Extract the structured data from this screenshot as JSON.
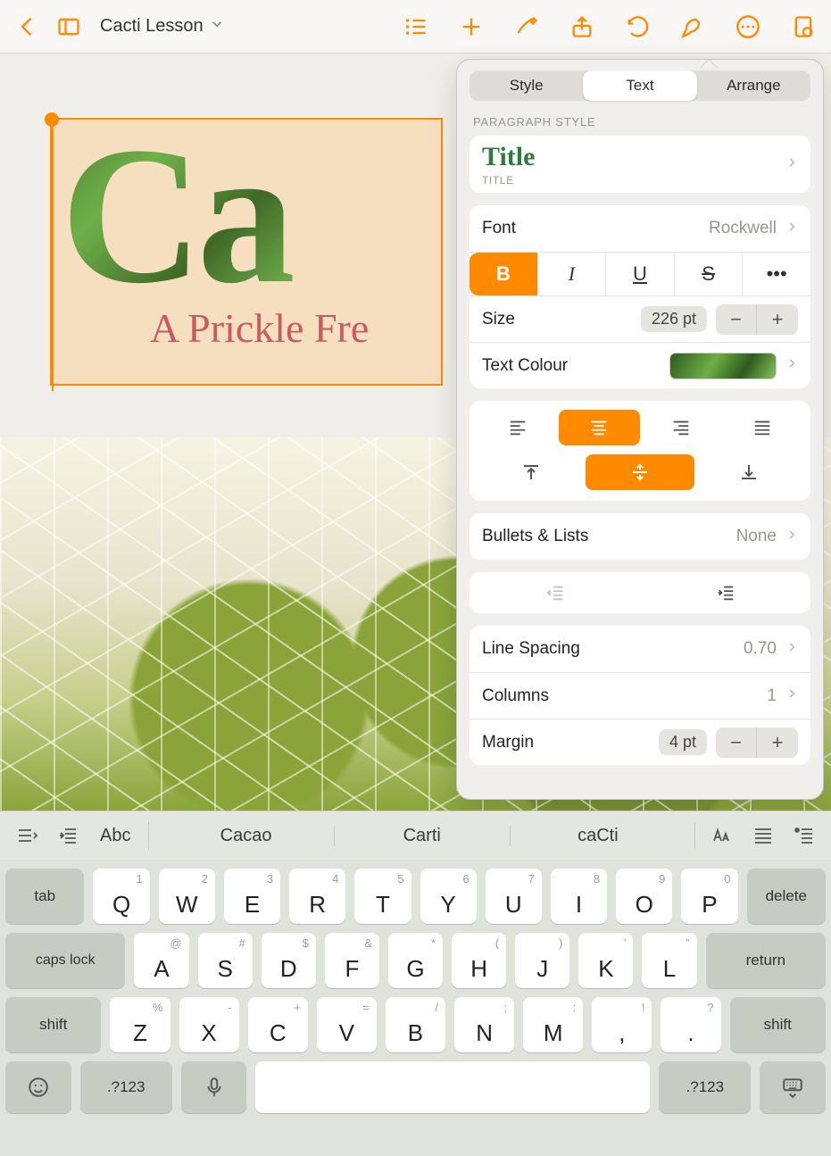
{
  "toolbar": {
    "doc_title": "Cacti Lesson"
  },
  "document": {
    "title_text": "Ca",
    "subtitle_text": "A Prickle Fre"
  },
  "popover": {
    "tabs": {
      "style": "Style",
      "text": "Text",
      "arrange": "Arrange"
    },
    "section_paragraph_style": "PARAGRAPH STYLE",
    "paragraph_style": {
      "name": "Title",
      "sub": "TITLE"
    },
    "font": {
      "label": "Font",
      "value": "Rockwell"
    },
    "size": {
      "label": "Size",
      "value": "226 pt"
    },
    "text_colour": {
      "label": "Text Colour"
    },
    "bullets": {
      "label": "Bullets & Lists",
      "value": "None"
    },
    "line_spacing": {
      "label": "Line Spacing",
      "value": "0.70"
    },
    "columns": {
      "label": "Columns",
      "value": "1"
    },
    "margin": {
      "label": "Margin",
      "value": "4 pt"
    }
  },
  "shortcut": {
    "abc": "Abc",
    "suggestions": [
      "Cacao",
      "Carti",
      "caCti"
    ]
  },
  "keyboard": {
    "row1_alts": [
      "1",
      "2",
      "3",
      "4",
      "5",
      "6",
      "7",
      "8",
      "9",
      "0"
    ],
    "row1": [
      "Q",
      "W",
      "E",
      "R",
      "T",
      "Y",
      "U",
      "I",
      "O",
      "P"
    ],
    "row2_alts": [
      "@",
      "#",
      "$",
      "&",
      "*",
      "(",
      ")",
      "’",
      "”"
    ],
    "row2": [
      "A",
      "S",
      "D",
      "F",
      "G",
      "H",
      "J",
      "K",
      "L"
    ],
    "row3_alts": [
      "%",
      "-",
      "+",
      "=",
      "/",
      ";",
      ":",
      "!",
      "?"
    ],
    "row3": [
      "Z",
      "X",
      "C",
      "V",
      "B",
      "N",
      "M",
      ",",
      "."
    ],
    "tab": "tab",
    "delete": "delete",
    "caps": "caps lock",
    "return": "return",
    "shift": "shift",
    "numbers": ".?123"
  }
}
